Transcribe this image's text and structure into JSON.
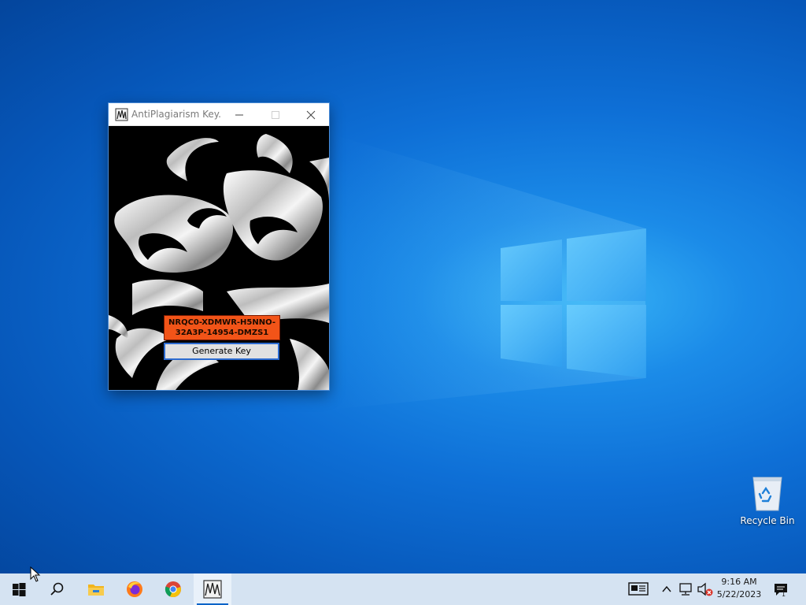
{
  "window": {
    "title": "AntiPlagiarism Key...",
    "key_line1": "NRQC0-XDMWR-H5NNO-",
    "key_line2": "32A3P-14954-DMZS1",
    "generate_label": "Generate Key"
  },
  "desktop": {
    "icons": [
      {
        "name": "recycle-bin",
        "label": "Recycle Bin"
      }
    ]
  },
  "taskbar": {
    "buttons": [
      "start",
      "search",
      "file-explorer",
      "firefox",
      "chrome",
      "antiplagiarism-keygen"
    ],
    "active": "antiplagiarism-keygen",
    "clock_time": "9:16 AM",
    "clock_date": "5/22/2023",
    "notification_count": "1"
  },
  "colors": {
    "key_background": "#f25418",
    "taskbar": "#d5e3f2",
    "desktop_blue": "#0e6fd6",
    "button_border": "#2c6bd0"
  }
}
